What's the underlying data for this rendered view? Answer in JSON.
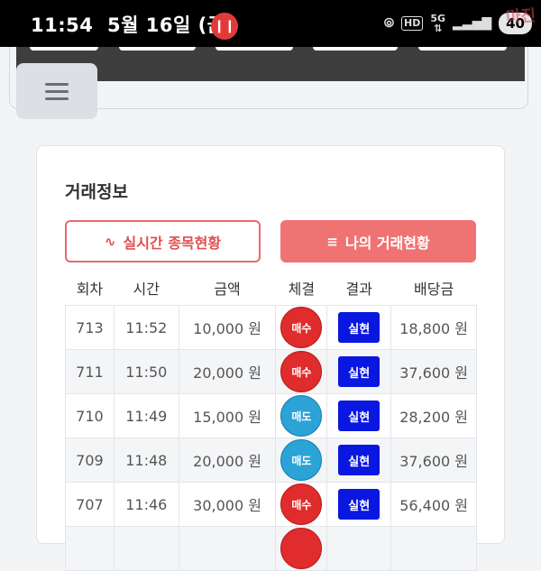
{
  "status_bar": {
    "time": "11:54",
    "date": "5월 16일 (금)",
    "battery": "40",
    "network": "5G",
    "hd": "HD",
    "watermark": "마진"
  },
  "colors": {
    "buy": "#e02c2c",
    "sell": "#2ba3d6",
    "result": "#0a17e0",
    "accent": "#f07373"
  },
  "card": {
    "title": "거래정보",
    "realtime_button": "실시간 종목현황",
    "my_trades_button": "나의 거래현황"
  },
  "table": {
    "headers": [
      "회차",
      "시간",
      "금액",
      "체결",
      "결과",
      "배당금"
    ],
    "rows": [
      {
        "round": "713",
        "time": "11:52",
        "amount": "10,000 원",
        "fill": "매수",
        "result": "실현",
        "payout": "18,800 원"
      },
      {
        "round": "711",
        "time": "11:50",
        "amount": "20,000 원",
        "fill": "매수",
        "result": "실현",
        "payout": "37,600 원"
      },
      {
        "round": "710",
        "time": "11:49",
        "amount": "15,000 원",
        "fill": "매도",
        "result": "실현",
        "payout": "28,200 원"
      },
      {
        "round": "709",
        "time": "11:48",
        "amount": "20,000 원",
        "fill": "매도",
        "result": "실현",
        "payout": "37,600 원"
      },
      {
        "round": "707",
        "time": "11:46",
        "amount": "30,000 원",
        "fill": "매수",
        "result": "실현",
        "payout": "56,400 원"
      }
    ]
  }
}
